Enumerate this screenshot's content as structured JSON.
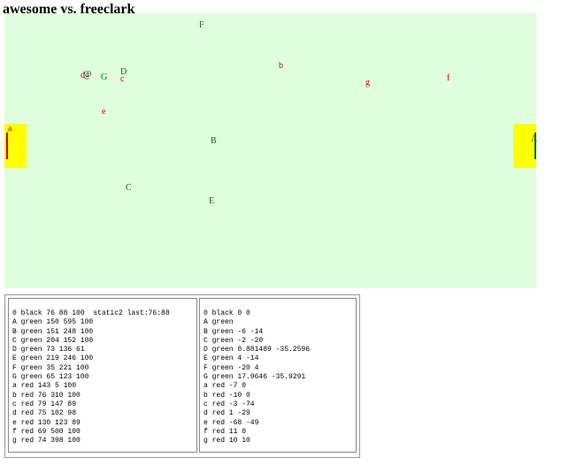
{
  "title": "awesome vs. freeclark",
  "field": {
    "ball": "@",
    "left_goal_label": "a",
    "right_goal_label": "A",
    "players": [
      {
        "label": "F",
        "team": "green"
      },
      {
        "label": "b",
        "team": "red"
      },
      {
        "label": "@",
        "team": "ball"
      },
      {
        "label": "d",
        "team": "red"
      },
      {
        "label": "G",
        "team": "green"
      },
      {
        "label": "D",
        "team": "green"
      },
      {
        "label": "c",
        "team": "red"
      },
      {
        "label": "g",
        "team": "red"
      },
      {
        "label": "f",
        "team": "red"
      },
      {
        "label": "e",
        "team": "red"
      },
      {
        "label": "B",
        "team": "green"
      },
      {
        "label": "C",
        "team": "green"
      },
      {
        "label": "E",
        "team": "green"
      }
    ]
  },
  "colors": {
    "field": "#dfffdc",
    "goal": "#ffff00",
    "green_team": "#007700",
    "red_team": "#cc0000"
  },
  "state_panel": [
    "0 black 76 88 100  static2 last:76:88",
    "A green 150 595 100",
    "B green 151 248 100",
    "C green 204 152 100",
    "D green 73 136 61",
    "E green 219 246 100",
    "F green 35 221 100",
    "G green 65 123 100",
    "a red 143 5 100",
    "b red 76 310 100",
    "c red 79 147 89",
    "d red 75 102 98",
    "e red 130 123 89",
    "f red 69 500 100",
    "g red 74 398 100"
  ],
  "command_panel": [
    "0 black 0 0",
    "A green",
    "B green -6 -14",
    "C green -2 -20",
    "D green 0.881489 -35.2596",
    "E green 4 -14",
    "F green -20 4",
    "G green 17.9646 -35.9291",
    "a red -7 0",
    "b red -10 0",
    "c red -3 -74",
    "d red 1 -29",
    "e red -68 -49",
    "f red 11 0",
    "g red 10 10"
  ]
}
